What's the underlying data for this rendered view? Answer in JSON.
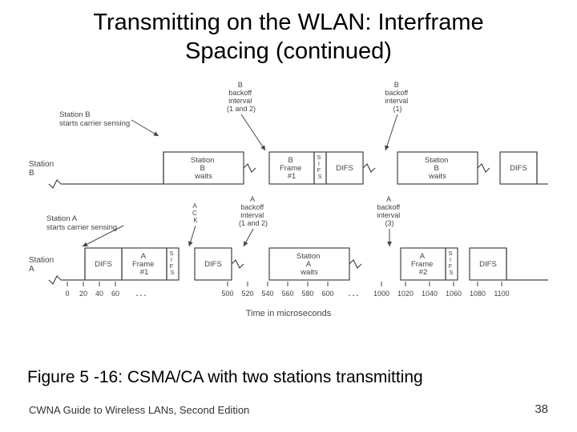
{
  "title_line1": "Transmitting on the WLAN: Interframe",
  "title_line2": "Spacing (continued)",
  "caption": "Figure 5 -16: CSMA/CA with two stations transmitting",
  "footer_left": "CWNA Guide to Wireless LANs, Second Edition",
  "footer_right": "38",
  "diagram": {
    "axis_label": "Time in microseconds",
    "row_b": {
      "label": "Station\nB",
      "sense_label": "Station B\nstarts carrier sensing",
      "top_label_1": "B\nbackoff\ninterval\n(1 and 2)",
      "top_label_2": "B\nbackoff\ninterval\n(1)",
      "boxes": [
        "Station\nB\nwaits",
        "B\nFrame\n#1",
        "S\nI\nF\nS",
        "DIFS",
        "Station\nB\nwaits",
        "DIFS"
      ]
    },
    "row_a": {
      "label": "Station\nA",
      "sense_label": "Station A\nstarts carrier sensing",
      "top_label_1": "A\nC\nK",
      "top_label_2": "A\nbackoff\ninterval\n(1 and 2)",
      "top_label_3": "A\nbackoff\ninterval\n(3)",
      "boxes": [
        "DIFS",
        "A\nFrame\n#1",
        "S\nI\nF\nS",
        "DIFS",
        "Station\nA\nwaits",
        "A\nFrame\n#2",
        "S\nI\nF\nS",
        "DIFS"
      ]
    },
    "ticks_left": [
      "0",
      "20",
      "40",
      "60"
    ],
    "ticks_mid": [
      "500",
      "520",
      "540",
      "560",
      "580",
      "600"
    ],
    "ticks_right": [
      "1000",
      "1020",
      "1040",
      "1060",
      "1080",
      "1100"
    ],
    "ellipsis": ". . ."
  }
}
